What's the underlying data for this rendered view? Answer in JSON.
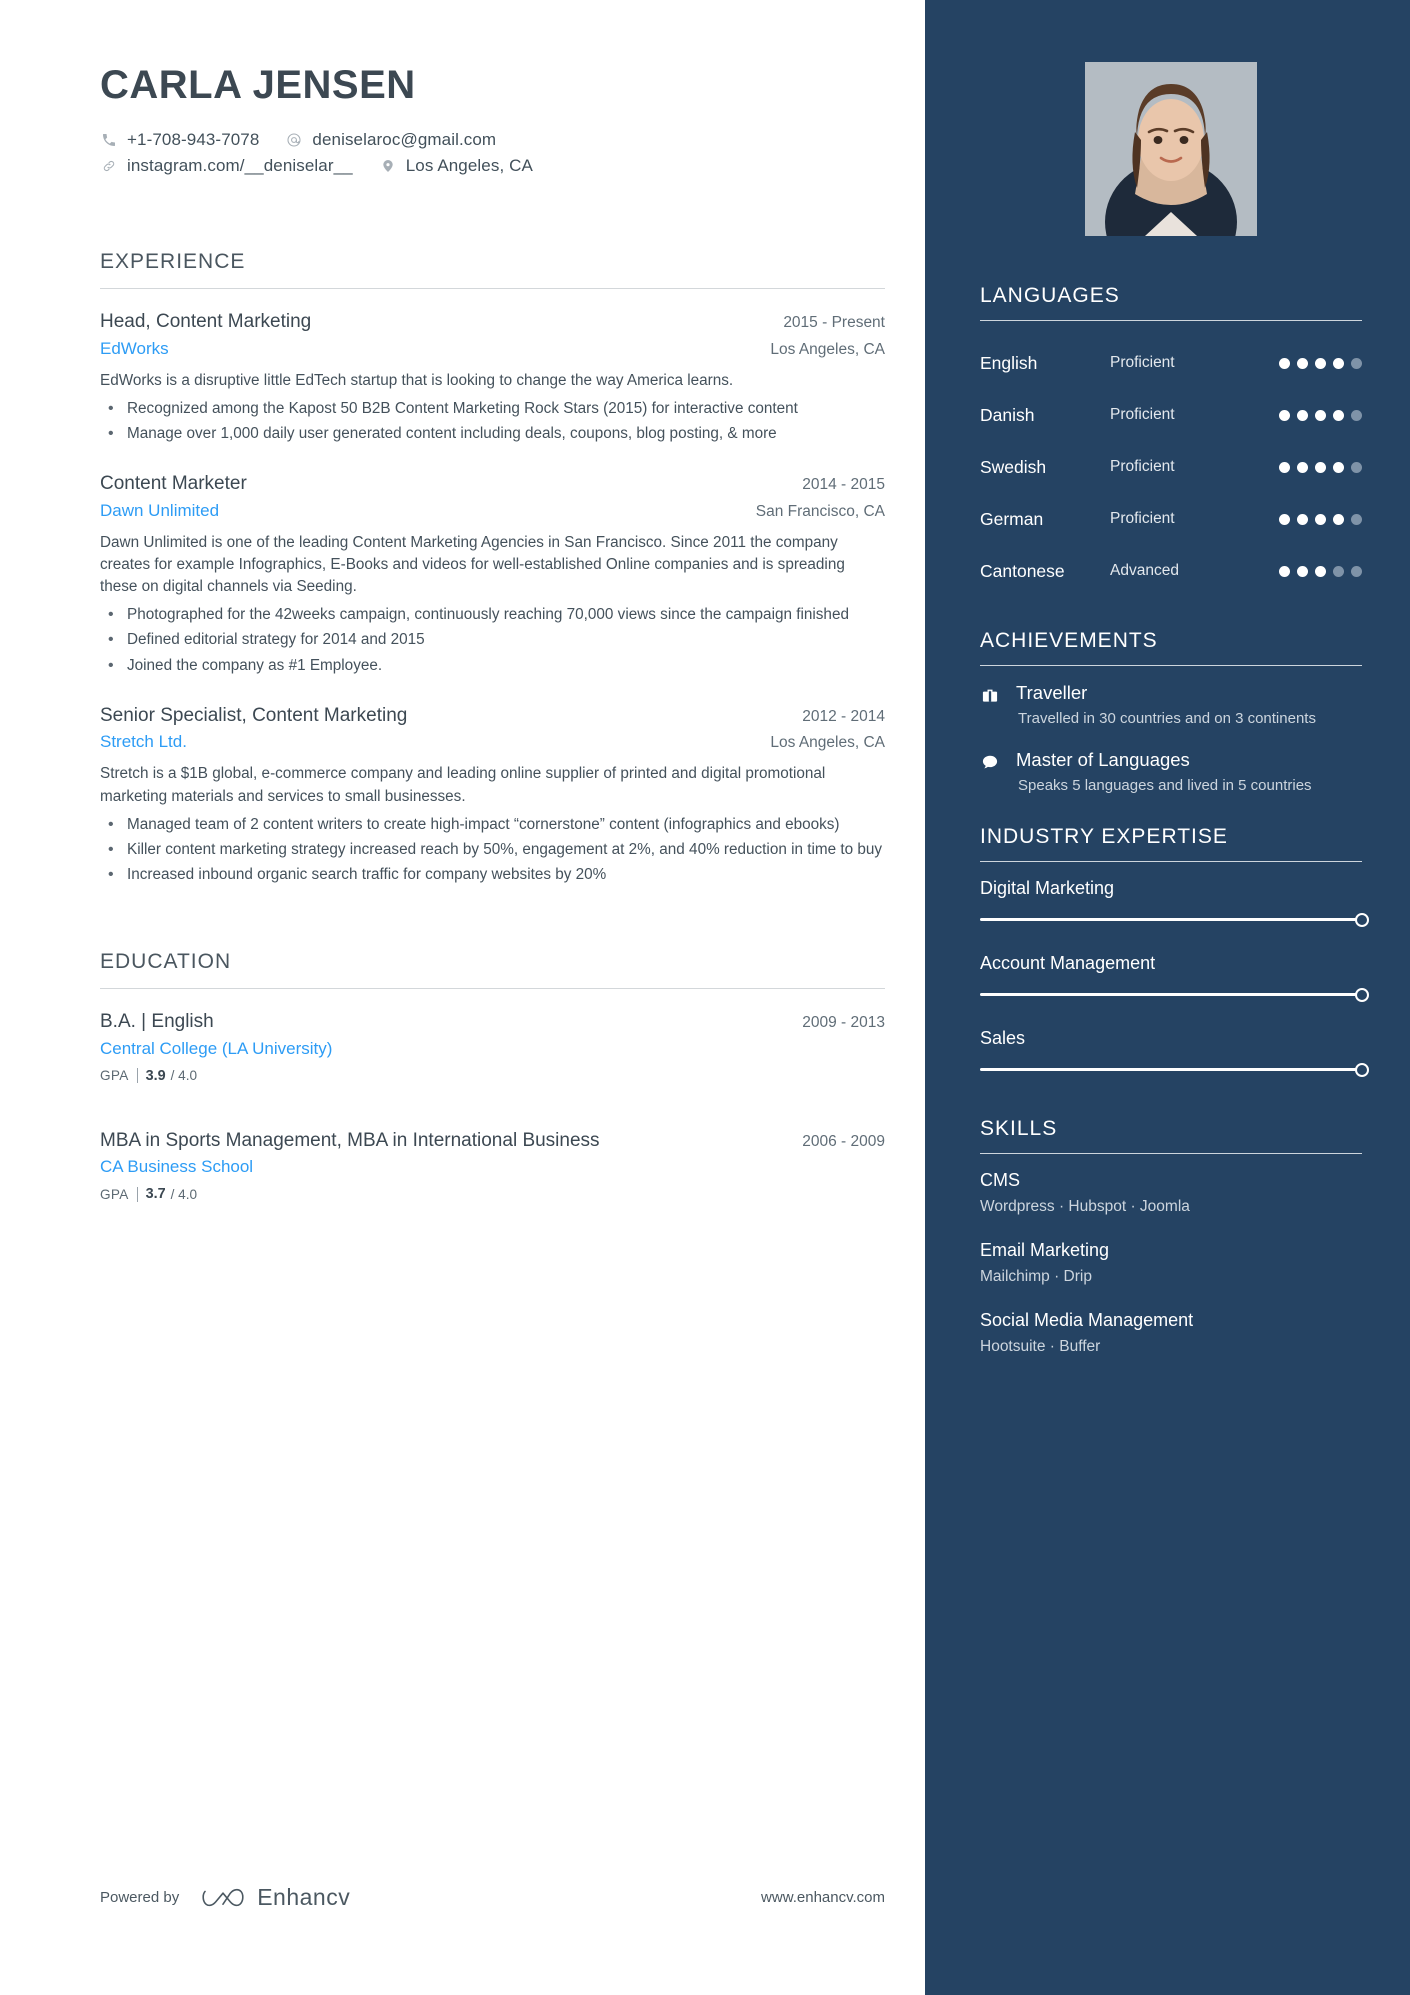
{
  "header": {
    "name": "CARLA JENSEN",
    "contacts": [
      {
        "icon": "phone-icon",
        "text": "+1-708-943-7078"
      },
      {
        "icon": "at-icon",
        "text": "deniselaroc@gmail.com"
      },
      {
        "icon": "link-icon",
        "text": "instagram.com/__deniselar__"
      },
      {
        "icon": "location-pin-icon",
        "text": "Los Angeles, CA"
      }
    ]
  },
  "experience": {
    "title": "EXPERIENCE",
    "entries": [
      {
        "role": "Head, Content Marketing",
        "date": "2015 - Present",
        "company": "EdWorks",
        "location": "Los Angeles, CA",
        "description": "EdWorks is a disruptive little EdTech startup that is looking to change the way America learns.",
        "bullets": [
          "Recognized among the Kapost 50 B2B Content Marketing Rock Stars (2015) for interactive content",
          "Manage over 1,000 daily user generated content including deals, coupons, blog posting, & more"
        ]
      },
      {
        "role": "Content Marketer",
        "date": "2014 - 2015",
        "company": "Dawn Unlimited",
        "location": "San Francisco, CA",
        "description": "Dawn Unlimited is one of the leading Content Marketing Agencies in San Francisco. Since 2011 the company creates for example Infographics, E-Books and videos for well-established Online companies and is spreading these on digital channels via Seeding.",
        "bullets": [
          "Photographed for the 42weeks campaign, continuously reaching 70,000 views since the campaign finished",
          "Defined editorial strategy for 2014 and 2015",
          "Joined the company as #1 Employee."
        ]
      },
      {
        "role": "Senior Specialist, Content Marketing",
        "date": "2012 - 2014",
        "company": "Stretch Ltd.",
        "location": "Los Angeles, CA",
        "description": "Stretch is a $1B global, e-commerce company and leading online supplier of printed and digital promotional marketing materials and services to small businesses.",
        "bullets": [
          "Managed team of 2 content writers to create high-impact “cornerstone” content (infographics and ebooks)",
          "Killer content marketing strategy increased reach by 50%, engagement at 2%, and 40% reduction in time to buy",
          "Increased inbound organic search traffic for company websites by 20%"
        ]
      }
    ]
  },
  "education": {
    "title": "EDUCATION",
    "entries": [
      {
        "degree": "B.A. | English",
        "date": "2009 - 2013",
        "school": "Central College (LA University)",
        "gpa_label": "GPA",
        "gpa_value": "3.9",
        "gpa_max": "/ 4.0"
      },
      {
        "degree": "MBA in Sports Management,  MBA in International Business",
        "date": "2006 - 2009",
        "school": "CA Business School",
        "gpa_label": "GPA",
        "gpa_value": "3.7",
        "gpa_max": "/ 4.0"
      }
    ]
  },
  "footer": {
    "powered_by": "Powered by",
    "brand": "Enhancv",
    "url": "www.enhancv.com"
  },
  "sidebar": {
    "photo_alt": "profile-photo",
    "languages": {
      "title": "LANGUAGES",
      "items": [
        {
          "name": "English",
          "level": "Proficient",
          "filled": 4,
          "total": 5
        },
        {
          "name": "Danish",
          "level": "Proficient",
          "filled": 4,
          "total": 5
        },
        {
          "name": "Swedish",
          "level": "Proficient",
          "filled": 4,
          "total": 5
        },
        {
          "name": "German",
          "level": "Proficient",
          "filled": 4,
          "total": 5
        },
        {
          "name": "Cantonese",
          "level": "Advanced",
          "filled": 3,
          "total": 5
        }
      ]
    },
    "achievements": {
      "title": "ACHIEVEMENTS",
      "items": [
        {
          "icon": "briefcase-icon",
          "title": "Traveller",
          "description": "Travelled in 30 countries and on 3 continents"
        },
        {
          "icon": "speech-bubble-icon",
          "title": "Master of Languages",
          "description": "Speaks 5 languages and lived in 5 countries"
        }
      ]
    },
    "industry_expertise": {
      "title": "INDUSTRY EXPERTISE",
      "items": [
        {
          "label": "Digital Marketing",
          "percent": 100
        },
        {
          "label": "Account Management",
          "percent": 100
        },
        {
          "label": "Sales",
          "percent": 100
        }
      ]
    },
    "skills": {
      "title": "SKILLS",
      "items": [
        {
          "name": "CMS",
          "tools": "Wordpress · Hubspot · Joomla"
        },
        {
          "name": "Email Marketing",
          "tools": "Mailchimp · Drip"
        },
        {
          "name": "Social Media Management",
          "tools": "Hootsuite · Buffer"
        }
      ]
    }
  },
  "colors": {
    "sidebar_bg": "#254363",
    "accent_link": "#2d9cf5",
    "heading": "#3c4852",
    "body_text": "#44515b"
  }
}
